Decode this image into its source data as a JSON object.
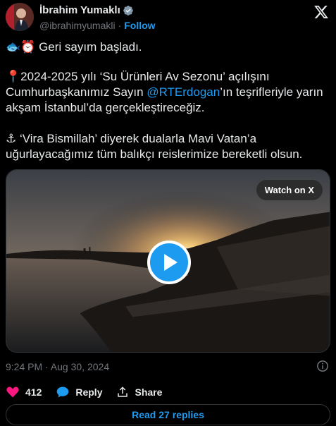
{
  "author": {
    "name": "İbrahim Yumaklı",
    "handle": "@ibrahimyumakli",
    "separator": "·",
    "follow_label": "Follow",
    "verified_color": "#829aab"
  },
  "post": {
    "line1_emoji": "🐟⏰",
    "line1_text": "Geri sayım başladı.",
    "para2_emoji": "📍",
    "para2_before": "2024-2025 yılı ‘Su Ürünleri Av Sezonu’ açılışını Cumhurbaşkanımız Sayın ",
    "para2_mention": "@RTErdogan",
    "para2_after": "’ın teşrifleriyle yarın akşam İstanbul’da gerçekleştireceğiz.",
    "para3_emoji": "⚓",
    "para3_text": " ‘Vira Bismillah’ diyerek dualarla Mavi Vatan’a uğurlayacağımız tüm balıkçı reislerimize bereketli olsun."
  },
  "media": {
    "watch_label": "Watch on X",
    "play_icon": "play-icon"
  },
  "timestamp": "9:24 PM · Aug 30, 2024",
  "actions": {
    "like_count": "412",
    "reply_label": "Reply",
    "share_label": "Share"
  },
  "read_replies_label": "Read 27 replies",
  "colors": {
    "accent": "#1d9bf0",
    "like": "#f91880",
    "background": "#000000",
    "muted": "#71767b"
  }
}
